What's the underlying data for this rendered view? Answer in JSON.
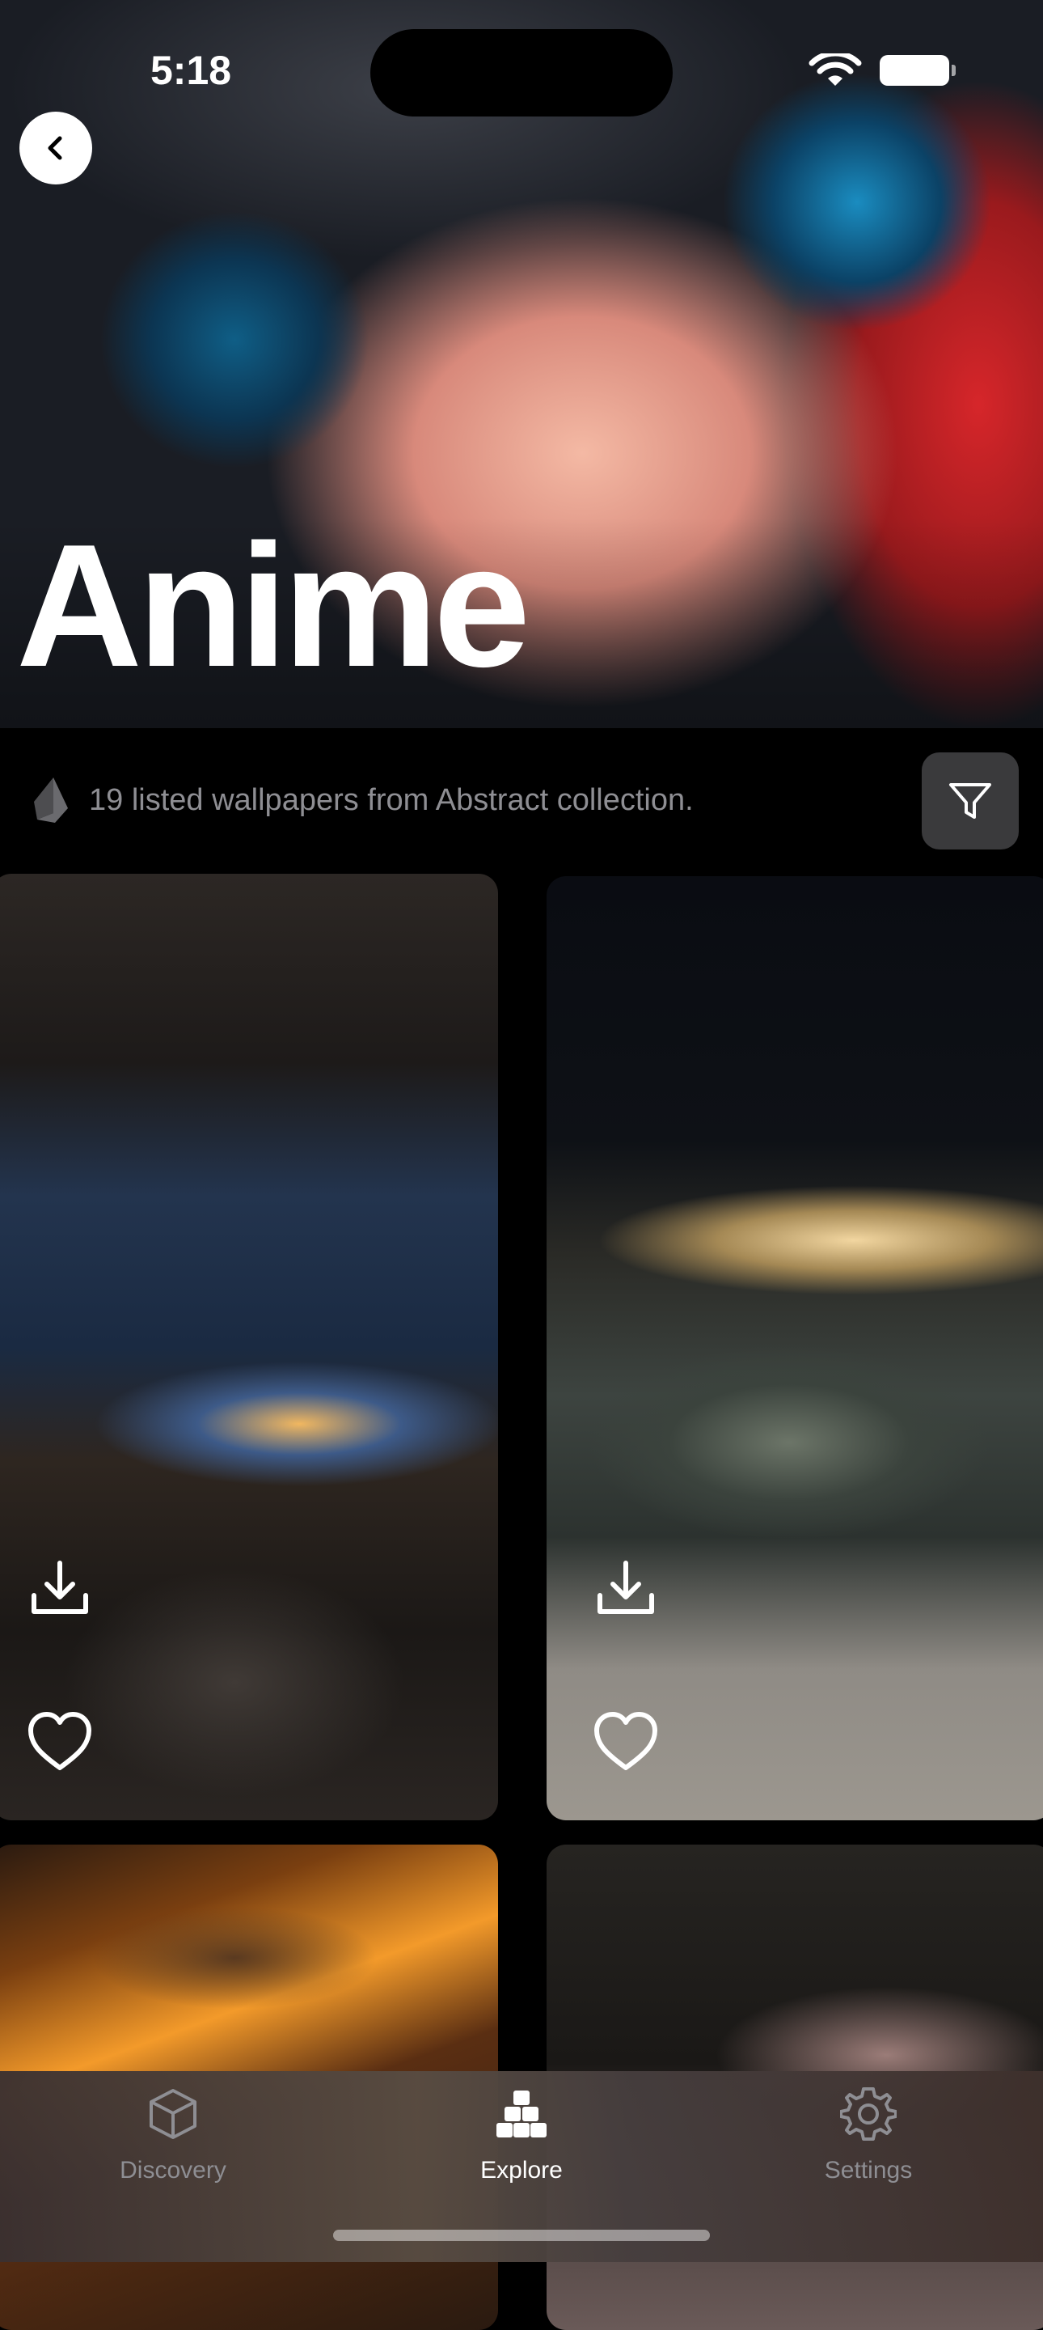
{
  "status_bar": {
    "time": "5:18"
  },
  "header": {
    "title": "Anime"
  },
  "info": {
    "text": "19 listed wallpapers from Abstract collection."
  },
  "icons": {
    "back": "chevron-left-icon",
    "collection": "layers-icon",
    "filter": "funnel-icon",
    "download": "download-icon",
    "favorite": "heart-icon"
  },
  "tabs": [
    {
      "label": "Discovery",
      "icon": "cube-icon",
      "active": false
    },
    {
      "label": "Explore",
      "icon": "blocks-icon",
      "active": true
    },
    {
      "label": "Settings",
      "icon": "gear-icon",
      "active": false
    }
  ],
  "colors": {
    "background": "#000000",
    "inactive_text": "#8e8e93",
    "active_text": "#ffffff",
    "filter_button": "#3a3a3c"
  }
}
